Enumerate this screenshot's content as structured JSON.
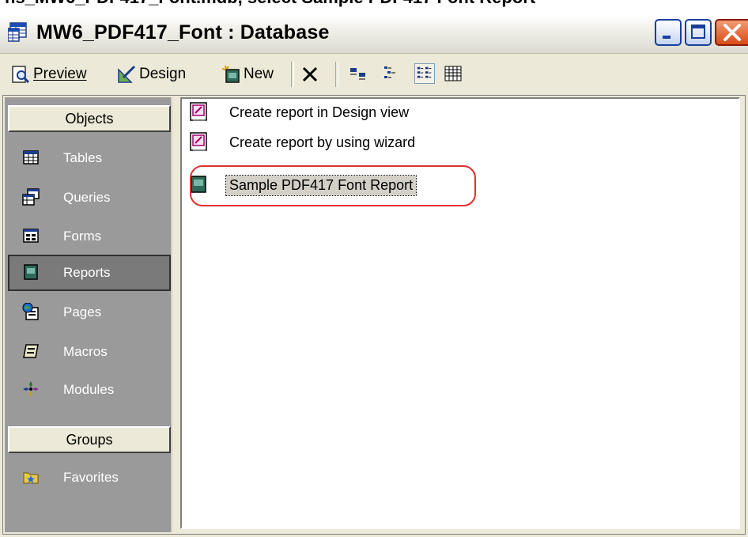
{
  "caption": "ns_MW6_PDF417_Font.mdb, select Sample PDF417 Font Report",
  "window": {
    "title": "MW6_PDF417_Font : Database",
    "controls": {
      "minimize": "minimize",
      "maximize": "maximize",
      "close": "close"
    }
  },
  "toolbar": {
    "preview_label": "Preview",
    "design_label": "Design",
    "new_label": "New"
  },
  "objects_bar": {
    "objects_header": "Objects",
    "items": [
      {
        "label": "Tables",
        "icon": "table-icon"
      },
      {
        "label": "Queries",
        "icon": "query-icon"
      },
      {
        "label": "Forms",
        "icon": "form-icon"
      },
      {
        "label": "Reports",
        "icon": "report-icon"
      },
      {
        "label": "Pages",
        "icon": "page-icon"
      },
      {
        "label": "Macros",
        "icon": "macro-icon"
      },
      {
        "label": "Modules",
        "icon": "module-icon"
      }
    ],
    "selected": "Reports",
    "groups_header": "Groups",
    "groups": [
      {
        "label": "Favorites",
        "icon": "favorites-icon"
      }
    ]
  },
  "list": {
    "items": [
      {
        "label": "Create report in Design view"
      },
      {
        "label": "Create report by using wizard"
      },
      {
        "label": "Sample PDF417 Font Report"
      }
    ],
    "selected": "Sample PDF417 Font Report"
  },
  "colors": {
    "highlight_oval": "#e03030",
    "objects_bar_bg": "#9a9a9a",
    "window_bg": "#ece9d8"
  }
}
